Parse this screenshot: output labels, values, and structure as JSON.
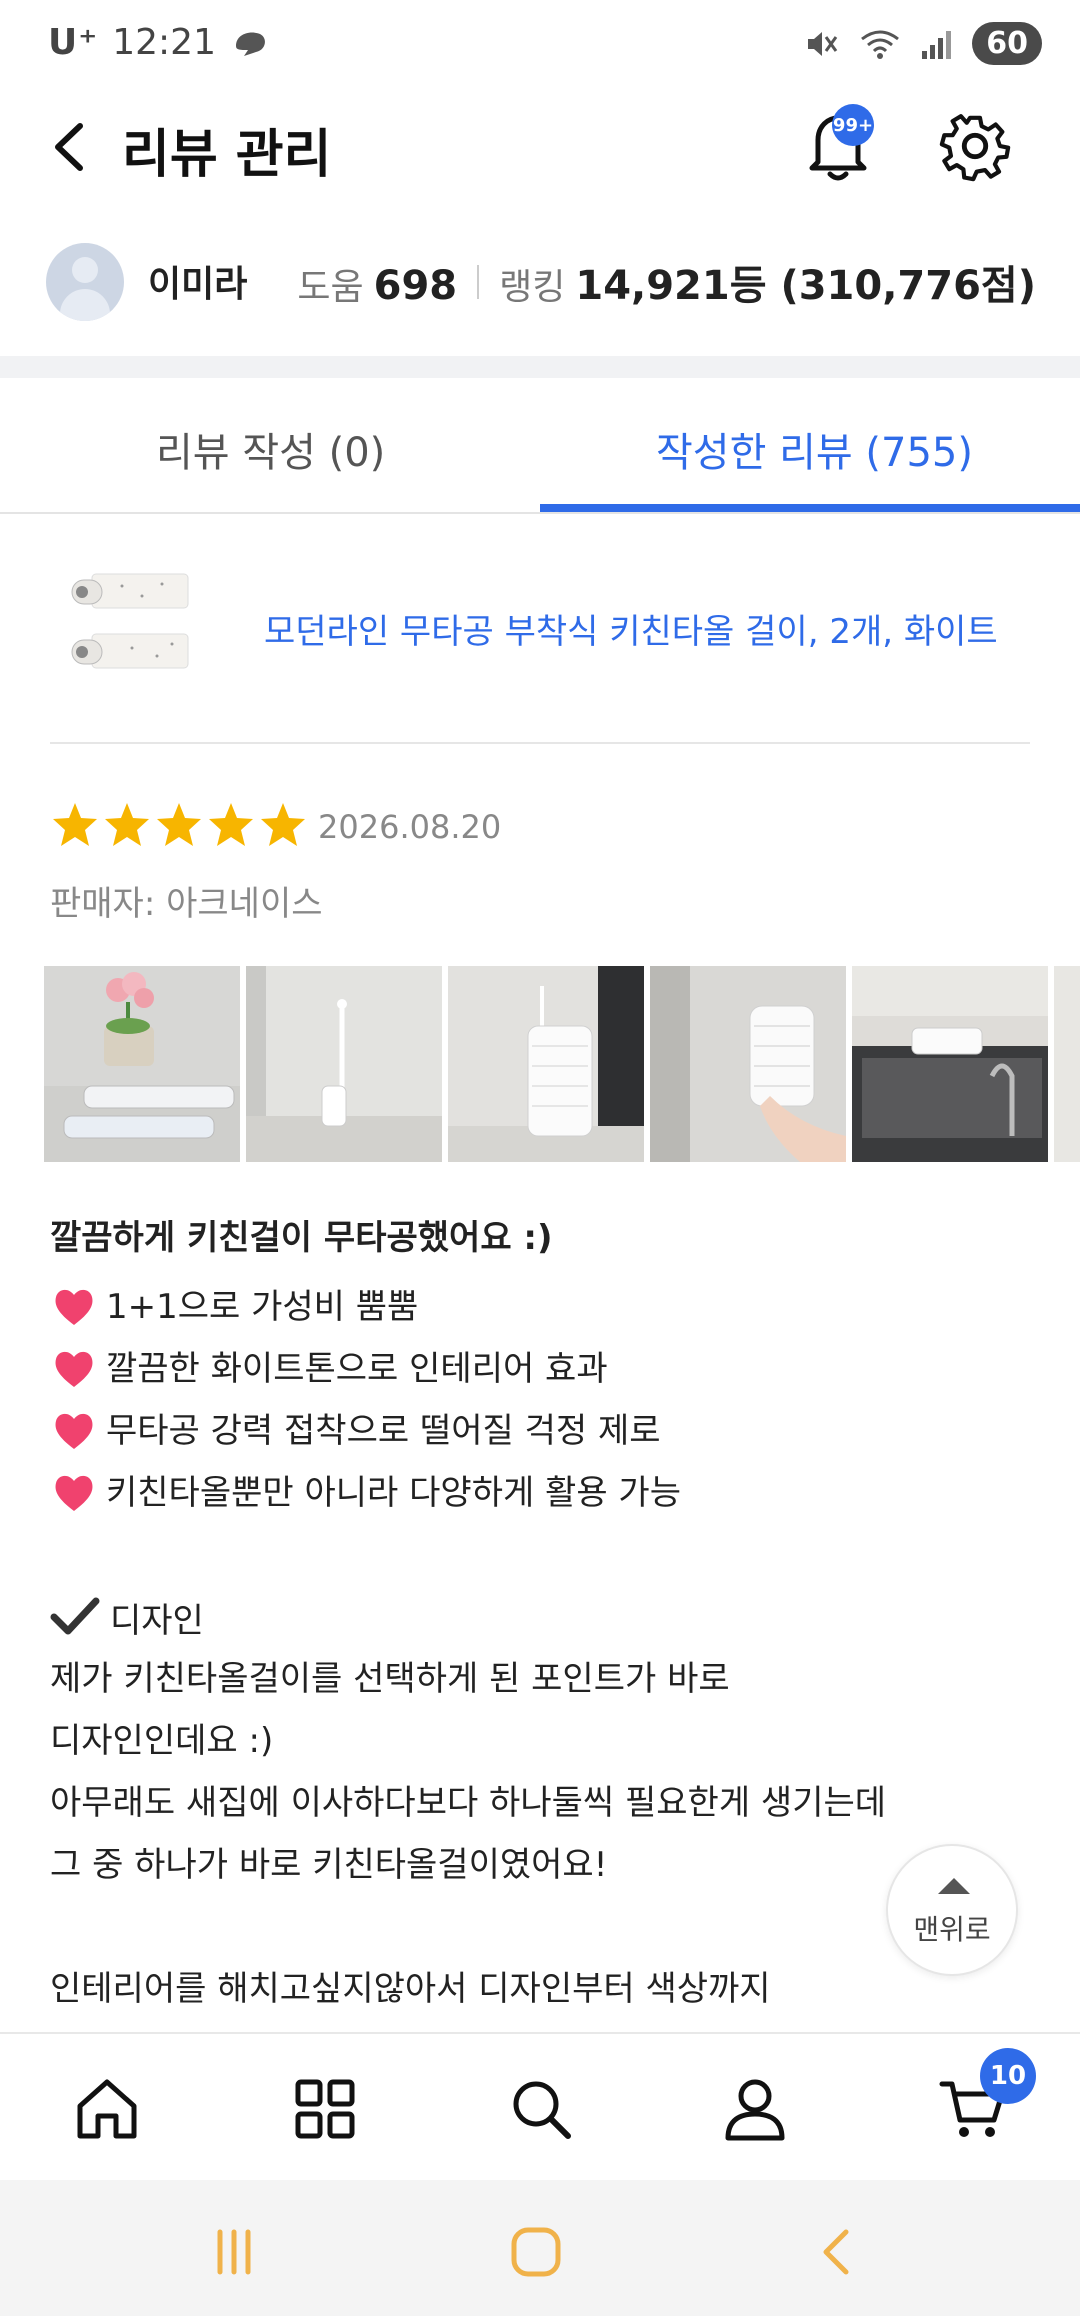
{
  "status_bar": {
    "carrier": "U⁺",
    "time": "12:21",
    "battery": "60"
  },
  "header": {
    "title": "리뷰 관리",
    "notification_badge": "99+"
  },
  "profile": {
    "name": "이미라",
    "help_label": "도움",
    "help_count": "698",
    "rank_label": "랭킹",
    "rank_value": "14,921등 (310,776점)"
  },
  "tabs": [
    {
      "label": "리뷰 작성 (0)",
      "active": false
    },
    {
      "label": "작성한 리뷰 (755)",
      "active": true
    }
  ],
  "product": {
    "name": "모던라인 무타공 부착식 키친타올 걸이, 2개, 화이트"
  },
  "review": {
    "rating": 5,
    "date": "2026.08.20",
    "seller": "판매자: 아크네이스",
    "headline": "깔끔하게 키친걸이 무타공했어요 :)",
    "bullets": [
      "1+1으로 가성비 뿜뿜",
      "깔끔한 화이트톤으로 인테리어 효과",
      "무타공 강력 접착으로 떨어질 걱정 제로",
      "키친타올뿐만 아니라 다양하게 활용 가능"
    ],
    "section_title": "디자인",
    "paragraph": [
      "제가 키친타올걸이를 선택하게 된 포인트가 바로",
      "디자인인데요 :)",
      "아무래도 새집에 이사하다보다 하나둘씩 필요한게 생기는데",
      "그 중 하나가 바로 키친타올걸이였어요!"
    ],
    "paragraph2": "인테리어를 해치고싶지않아서 디자인부터 색상까지"
  },
  "scroll_top": {
    "label": "맨위로"
  },
  "bottom_nav": {
    "items": [
      "home-icon",
      "grid-icon",
      "search-icon",
      "person-icon",
      "cart-icon"
    ],
    "cart_badge": "10"
  },
  "colors": {
    "accent": "#2f6be8",
    "star": "#f7b500",
    "heart": "#f0426e"
  }
}
